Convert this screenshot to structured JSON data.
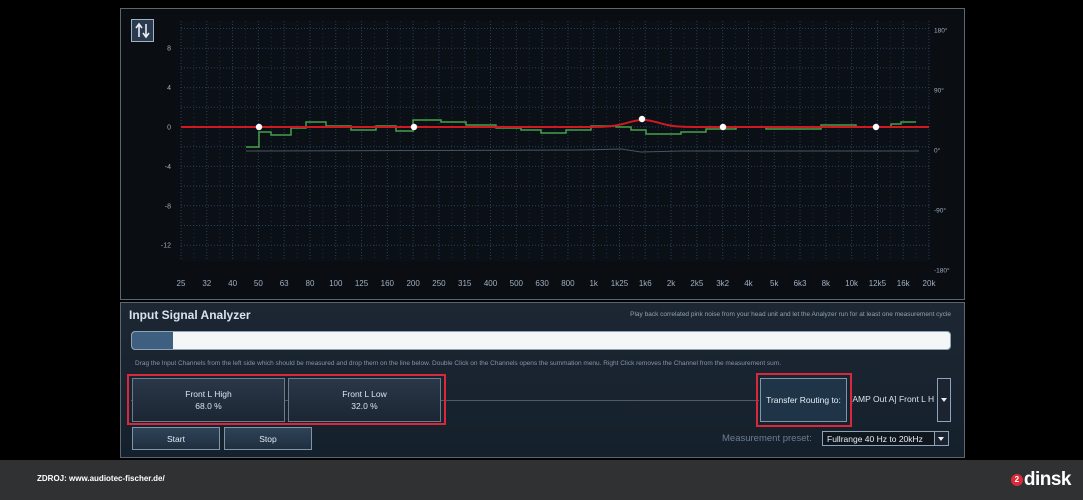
{
  "graph": {
    "y_left_ticks": [
      "8",
      "4",
      "0",
      "-4",
      "-8",
      "-12"
    ],
    "y_right_ticks": [
      "180°",
      "90°",
      "0°",
      "-90°",
      "-180°"
    ],
    "x_ticks": [
      "25",
      "32",
      "40",
      "50",
      "63",
      "80",
      "100",
      "125",
      "160",
      "200",
      "250",
      "315",
      "400",
      "500",
      "630",
      "800",
      "1k",
      "1k25",
      "1k6",
      "2k",
      "2k5",
      "3k2",
      "4k",
      "5k",
      "6k3",
      "8k",
      "10k",
      "12k5",
      "16k",
      "20k"
    ],
    "colors": {
      "grid": "#29405a",
      "target_curve": "#d01a1f",
      "measured": "#45a049",
      "phase": "#4a5560",
      "axis_text": "#9fb0c2"
    }
  },
  "analyzer": {
    "title": "Input Signal Analyzer",
    "hint": "Play back correlated pink noise from your head unit and let the Analyzer run for at least one measurement cycle",
    "progress_percent": 5,
    "instructions": "Drag the Input Channels from the left side which should be measured and drop them on the line below. Double Click on the Channels opens the summation menu. Right Click removes the Channel from the measurement sum.",
    "channels": [
      {
        "name": "Front L High",
        "value": "68.0 %"
      },
      {
        "name": "Front L Low",
        "value": "32.0 %"
      }
    ],
    "transfer_label": "Transfer Routing to:",
    "transfer_target": "[AMP Out A] Front L H",
    "start_label": "Start",
    "stop_label": "Stop",
    "preset_label": "Measurement preset:",
    "preset_value": "Fullrange 40 Hz to 20kHz"
  },
  "footer": {
    "source": "ZDROJ: www.audiotec-fischer.de/",
    "brand_mark": "2",
    "brand_name": "dinsk"
  },
  "icons": {
    "swap": "swap-vertical-icon",
    "dropdown": "chevron-down-icon"
  }
}
